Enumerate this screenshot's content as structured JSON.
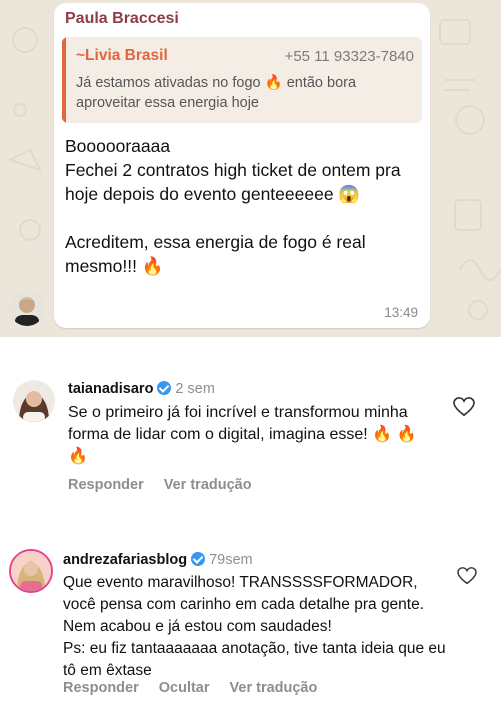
{
  "whatsapp": {
    "sender": "Paula Braccesi",
    "quote_name": "~Livia Brasil",
    "quote_phone": "+55 11 93323-7840",
    "quote_text": "Já estamos ativadas no fogo 🔥 então bora aproveitar essa energia hoje",
    "message": "Boooooraaaa\nFechei 2 contratos high ticket de ontem pra hoje depois do evento genteeeeee 😱\n\nAcreditem, essa energia de fogo é real mesmo!!! 🔥",
    "time": "13:49"
  },
  "comments": [
    {
      "username": "taianadisaro",
      "time": "2 sem",
      "text": "Se o primeiro já foi incrível e transformou minha forma de lidar com o digital, imagina esse! 🔥 🔥 🔥",
      "actions": [
        "Responder",
        "Ver tradução"
      ]
    },
    {
      "username": "andrezafariasblog",
      "time": "79sem",
      "text": "Que evento maravilhoso! TRANSSSSFORMADOR, você pensa com carinho em cada detalhe pra gente. Nem acabou e já estou com saudades!\nPs: eu fiz tantaaaaaaa anotação, tive tanta ideia que eu tô em êxtase",
      "actions": [
        "Responder",
        "Ocultar",
        "Ver tradução"
      ]
    }
  ],
  "icons": {
    "verified": "verified-badge-icon",
    "like": "heart-outline-icon"
  },
  "colors": {
    "sender": "#8c3d4c",
    "quote_accent": "#e0663c",
    "verified": "#3897f0",
    "muted": "#8e8e8e"
  }
}
